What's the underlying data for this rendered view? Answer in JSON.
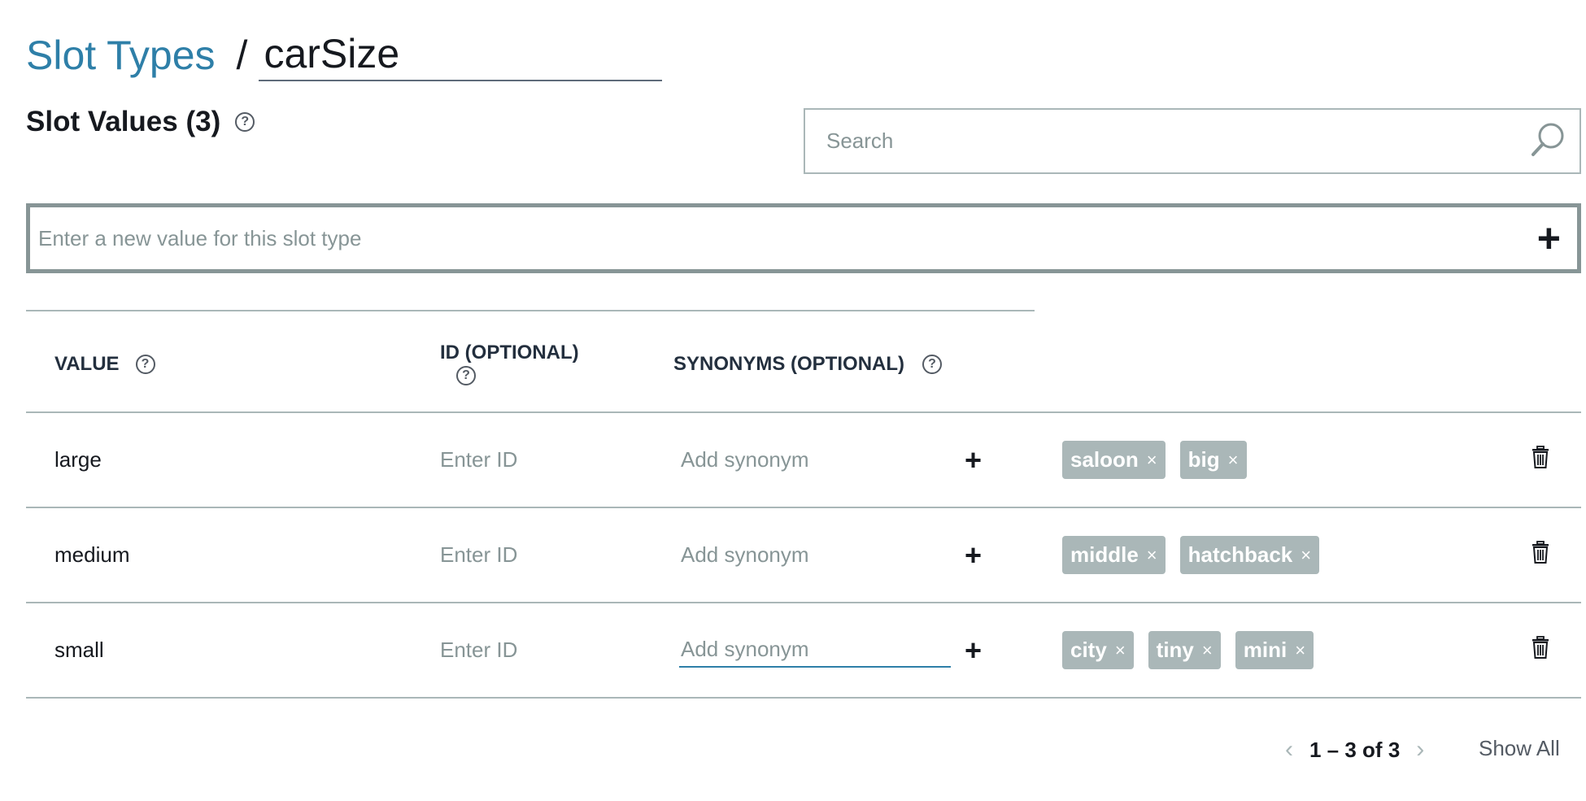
{
  "breadcrumb": {
    "parent": "Slot Types",
    "separator": "/",
    "current": "carSize"
  },
  "section": {
    "title": "Slot Values (3)",
    "help": "?"
  },
  "search": {
    "placeholder": "Search"
  },
  "new_value": {
    "placeholder": "Enter a new value for this slot type",
    "add": "+"
  },
  "table": {
    "headers": {
      "value": "VALUE",
      "id": "ID (OPTIONAL)",
      "synonyms": "SYNONYMS (OPTIONAL)"
    },
    "help": "?",
    "rows": [
      {
        "value": "large",
        "id_placeholder": "Enter ID",
        "synonym_placeholder": "Add synonym",
        "add": "+",
        "synonyms": [
          "saloon",
          "big"
        ]
      },
      {
        "value": "medium",
        "id_placeholder": "Enter ID",
        "synonym_placeholder": "Add synonym",
        "add": "+",
        "synonyms": [
          "middle",
          "hatchback"
        ]
      },
      {
        "value": "small",
        "id_placeholder": "Enter ID",
        "synonym_placeholder": "Add synonym",
        "add": "+",
        "synonyms": [
          "city",
          "tiny",
          "mini"
        ]
      }
    ],
    "remove_tag": "×"
  },
  "pagination": {
    "range": "1 – 3 of 3",
    "prev": "‹",
    "next": "›",
    "show_all": "Show All"
  },
  "colors": {
    "link": "#2e7fa8",
    "tag_bg": "#aab7b8",
    "border": "#aab7b8"
  }
}
